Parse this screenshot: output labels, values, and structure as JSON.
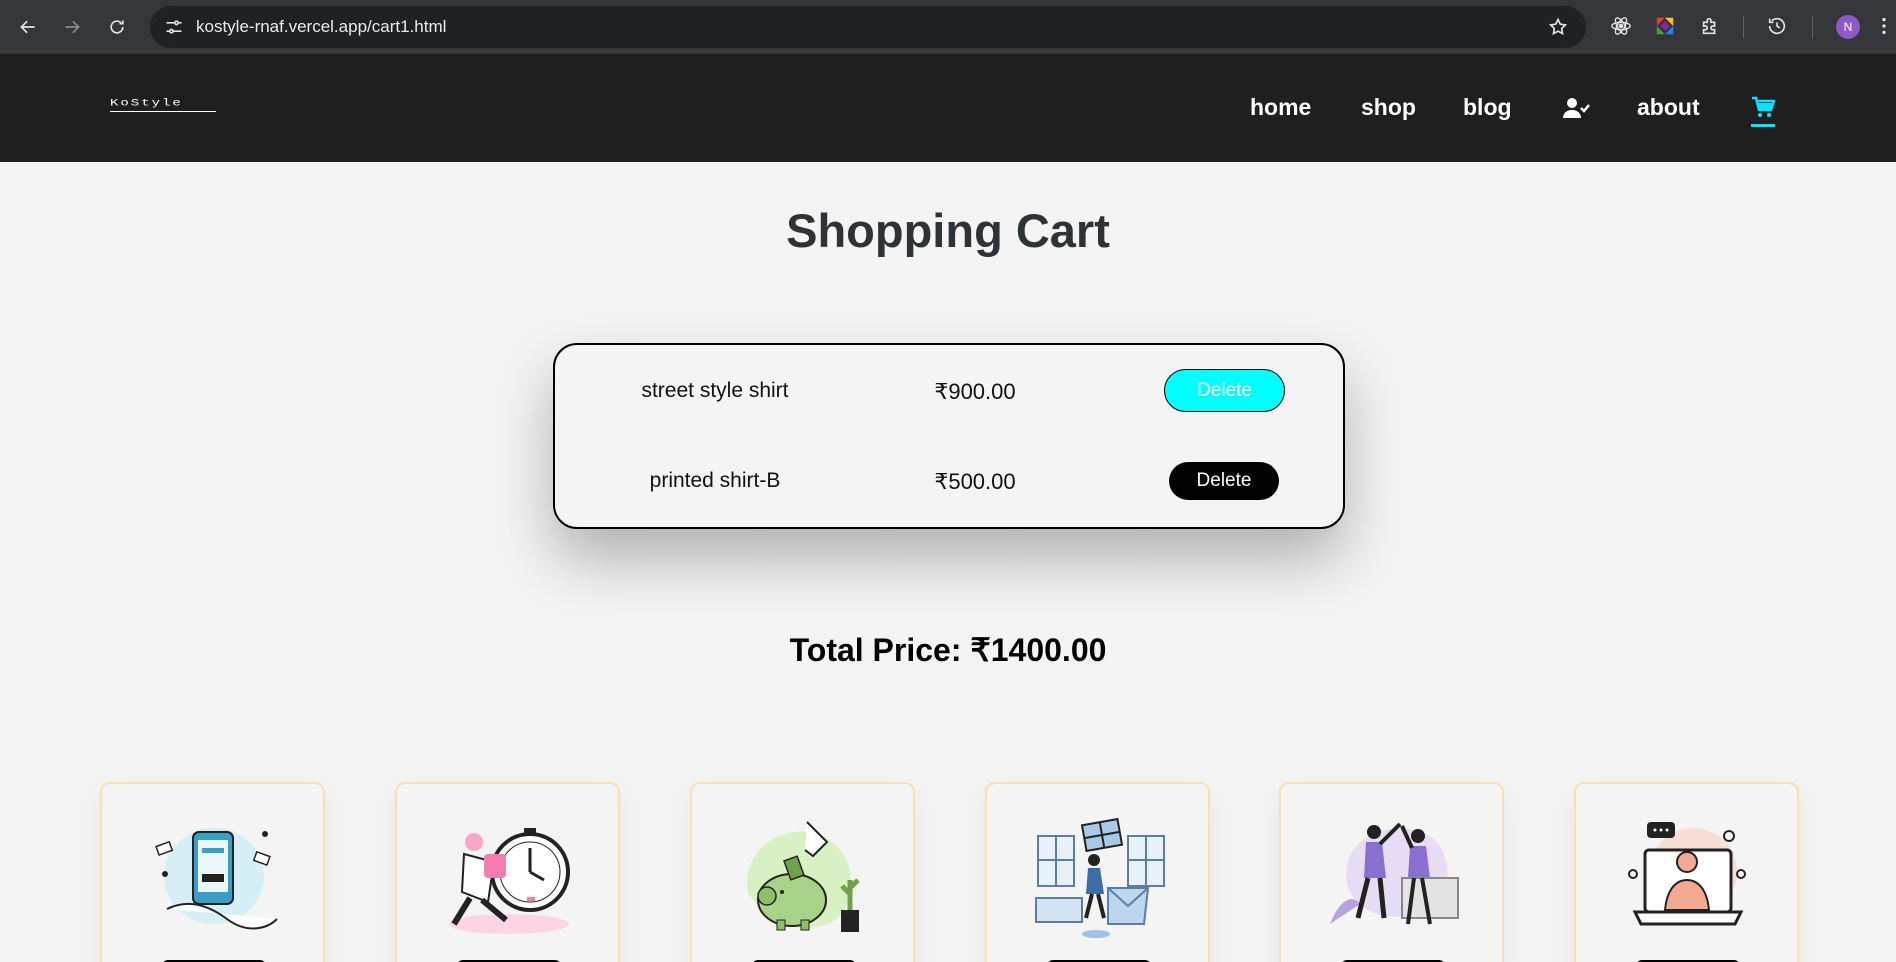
{
  "browser": {
    "url": "kostyle-rnaf.vercel.app/cart1.html",
    "profile_initial": "N",
    "icons": [
      "back-icon",
      "forward-icon",
      "reload-icon",
      "site-info-icon",
      "bookmark-star-icon",
      "react-devtools-icon",
      "colorful-extension-icon",
      "extensions-puzzle-icon",
      "history-icon"
    ]
  },
  "site": {
    "logo": "KoStyle",
    "nav": {
      "home": "home",
      "shop": "shop",
      "blog": "blog",
      "about": "about",
      "user_icon": "user-check-icon",
      "cart_icon": "cart-icon"
    },
    "accent_color": "#00ffff"
  },
  "cart": {
    "title": "Shopping Cart",
    "items": [
      {
        "name": "street style shirt",
        "price": "₹900.00",
        "delete_label": "Delete"
      },
      {
        "name": "printed shirt-B",
        "price": "₹500.00",
        "delete_label": "Delete"
      }
    ],
    "total": "Total Price: ₹1400.00"
  },
  "features": {
    "illustrations": [
      "mobile-payment-illustration",
      "fast-delivery-illustration",
      "savings-piggy-bank-illustration",
      "gift-shopping-illustration",
      "happy-customers-illustration",
      "online-support-illustration"
    ]
  }
}
